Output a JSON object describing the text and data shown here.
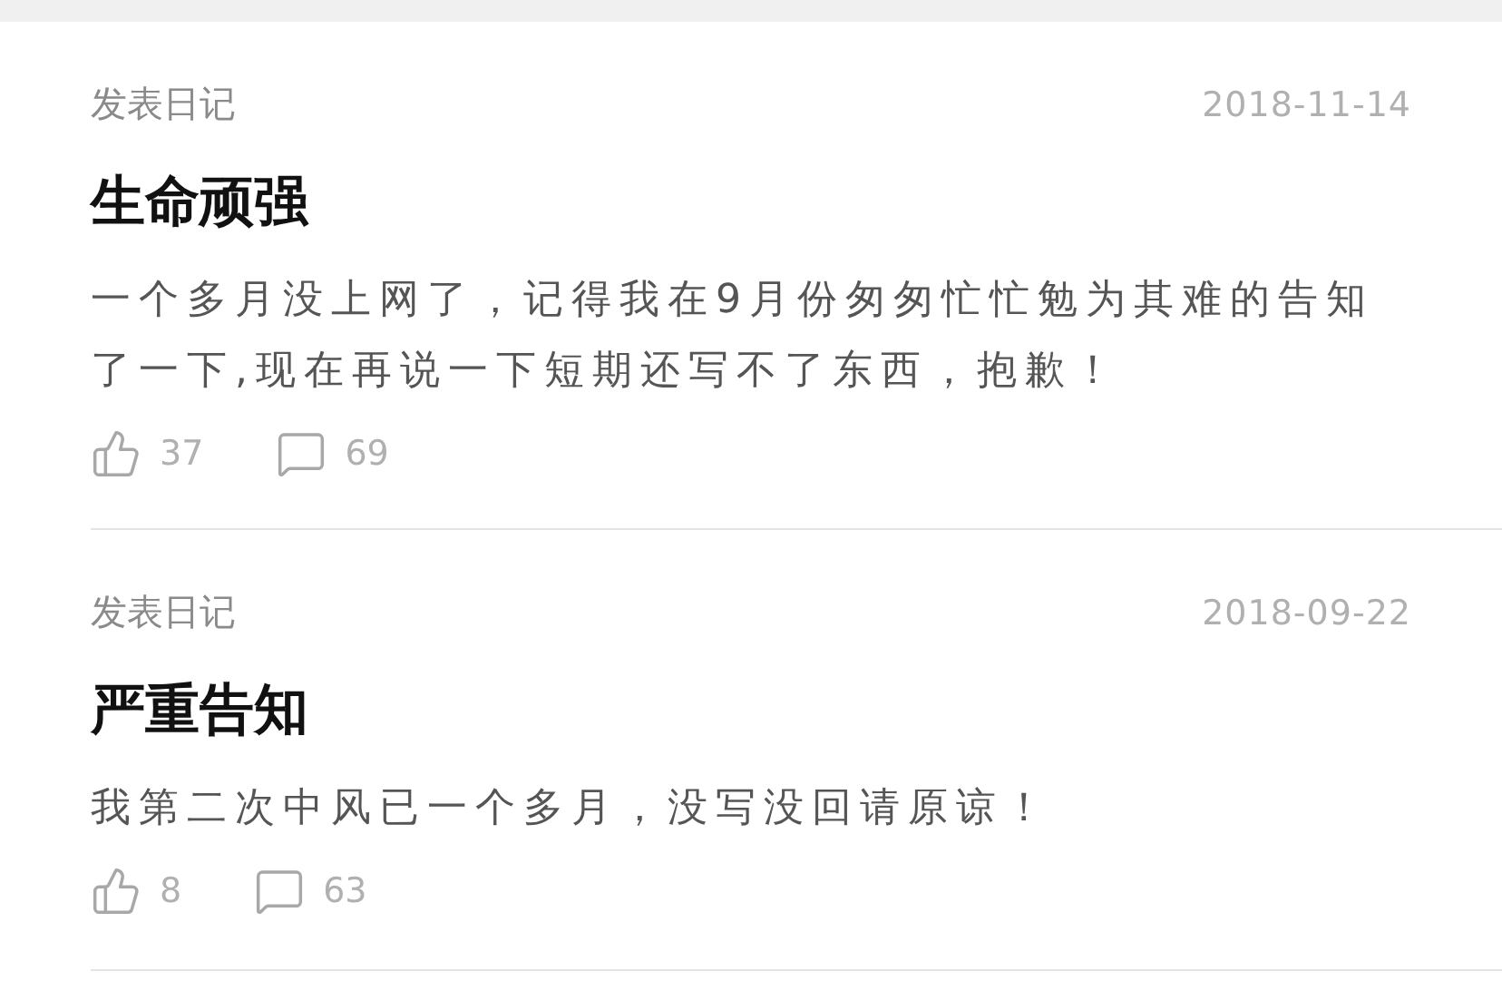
{
  "posts": [
    {
      "label": "发表日记",
      "date": "2018-11-14",
      "title": "生命顽强",
      "body": "一个多月没上网了，记得我在9月份匆匆忙忙勉为其难的告知了一下,现在再说一下短期还写不了东西，抱歉！",
      "likes": "37",
      "comments": "69"
    },
    {
      "label": "发表日记",
      "date": "2018-09-22",
      "title": "严重告知",
      "body": "我第二次中风已一个多月，没写没回请原谅！",
      "likes": "8",
      "comments": "63"
    }
  ]
}
